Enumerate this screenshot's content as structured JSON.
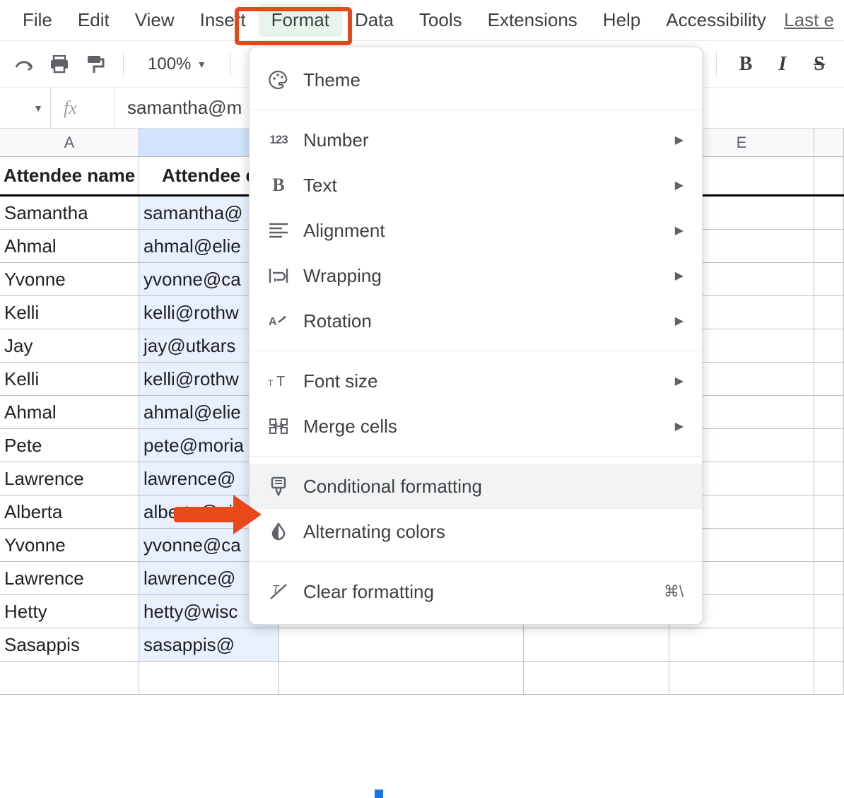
{
  "menubar": {
    "items": [
      "File",
      "Edit",
      "View",
      "Insert",
      "Format",
      "Data",
      "Tools",
      "Extensions",
      "Help",
      "Accessibility"
    ],
    "link": "Last e"
  },
  "toolbar": {
    "zoom": "100%"
  },
  "formula_bar": {
    "fx": "fx",
    "value": "samantha@m"
  },
  "columns": [
    "A",
    "",
    "",
    "",
    "E",
    ""
  ],
  "headers": {
    "A": "Attendee name",
    "B": "Attendee e"
  },
  "rows": [
    {
      "a": "Samantha",
      "b": "samantha@"
    },
    {
      "a": "Ahmal",
      "b": "ahmal@elie"
    },
    {
      "a": "Yvonne",
      "b": "yvonne@ca"
    },
    {
      "a": "Kelli",
      "b": "kelli@rothw"
    },
    {
      "a": "Jay",
      "b": "jay@utkars"
    },
    {
      "a": "Kelli",
      "b": "kelli@rothw"
    },
    {
      "a": "Ahmal",
      "b": "ahmal@elie"
    },
    {
      "a": "Pete",
      "b": "pete@moria"
    },
    {
      "a": "Lawrence",
      "b": "lawrence@"
    },
    {
      "a": "Alberta",
      "b": "alberta@pi"
    },
    {
      "a": "Yvonne",
      "b": "yvonne@ca"
    },
    {
      "a": "Lawrence",
      "b": "lawrence@"
    },
    {
      "a": "Hetty",
      "b": "hetty@wisc"
    },
    {
      "a": "Sasappis",
      "b": "sasappis@"
    }
  ],
  "dropdown": {
    "theme": "Theme",
    "number": "Number",
    "text": "Text",
    "alignment": "Alignment",
    "wrapping": "Wrapping",
    "rotation": "Rotation",
    "fontsize": "Font size",
    "merge": "Merge cells",
    "conditional": "Conditional formatting",
    "alternating": "Alternating colors",
    "clear": "Clear formatting",
    "clear_short": "⌘\\"
  }
}
